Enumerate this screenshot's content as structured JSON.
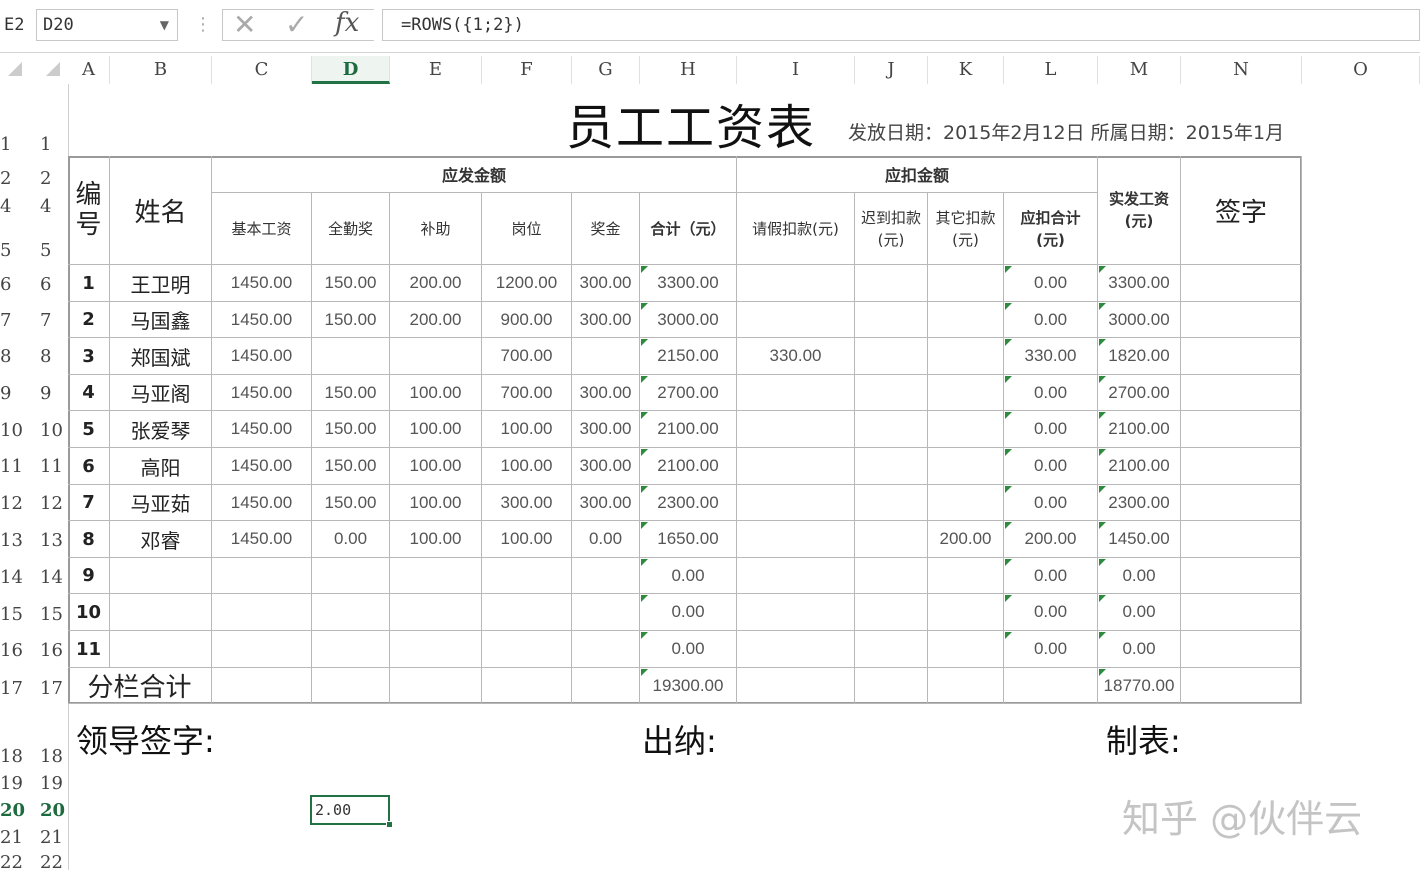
{
  "formula_bar": {
    "cell_hint": "E2",
    "name_box": "D20",
    "formula": "=ROWS({1;2})"
  },
  "columns": [
    "A",
    "B",
    "C",
    "D",
    "E",
    "F",
    "G",
    "H",
    "I",
    "J",
    "K",
    "L",
    "M",
    "N",
    "O"
  ],
  "selected_column": "D",
  "selected_row": "20",
  "rows": [
    {
      "a": "1",
      "b": "1"
    },
    {
      "a": "2",
      "b": "2"
    },
    {
      "a": "4",
      "b": "4"
    },
    {
      "a": "5",
      "b": "5"
    },
    {
      "a": "6",
      "b": "6"
    },
    {
      "a": "7",
      "b": "7"
    },
    {
      "a": "8",
      "b": "8"
    },
    {
      "a": "9",
      "b": "9"
    },
    {
      "a": "10",
      "b": "10"
    },
    {
      "a": "11",
      "b": "11"
    },
    {
      "a": "12",
      "b": "12"
    },
    {
      "a": "13",
      "b": "13"
    },
    {
      "a": "14",
      "b": "14"
    },
    {
      "a": "15",
      "b": "15"
    },
    {
      "a": "16",
      "b": "16"
    },
    {
      "a": "17",
      "b": "17"
    },
    {
      "a": "18",
      "b": "18"
    },
    {
      "a": "19",
      "b": "19"
    },
    {
      "a": "20",
      "b": "20"
    },
    {
      "a": "21",
      "b": "21"
    },
    {
      "a": "22",
      "b": "22"
    }
  ],
  "sheet": {
    "title": "员工工资表",
    "dates": "发放日期：2015年2月12日 所属日期：2015年1月",
    "hdr_id": "编号",
    "hdr_name": "姓名",
    "group_pay": "应发金额",
    "group_deduct": "应扣金额",
    "hdr_net": "实发工资(元)",
    "hdr_sign": "签字",
    "sub_pay": [
      "基本工资",
      "全勤奖",
      "补助",
      "岗位",
      "奖金",
      "合计（元）"
    ],
    "sub_deduct": [
      "请假扣款(元)",
      "迟到扣款(元)",
      "其它扣款(元)",
      "应扣合计(元)"
    ],
    "employees": [
      {
        "id": "1",
        "name": "王卫明",
        "base": "1450.00",
        "attend": "150.00",
        "subsidy": "200.00",
        "post": "1200.00",
        "bonus": "300.00",
        "total": "3300.00",
        "leave": "",
        "late": "",
        "other": "",
        "deduct": "0.00",
        "net": "3300.00"
      },
      {
        "id": "2",
        "name": "马国鑫",
        "base": "1450.00",
        "attend": "150.00",
        "subsidy": "200.00",
        "post": "900.00",
        "bonus": "300.00",
        "total": "3000.00",
        "leave": "",
        "late": "",
        "other": "",
        "deduct": "0.00",
        "net": "3000.00"
      },
      {
        "id": "3",
        "name": "郑国斌",
        "base": "1450.00",
        "attend": "",
        "subsidy": "",
        "post": "700.00",
        "bonus": "",
        "total": "2150.00",
        "leave": "330.00",
        "late": "",
        "other": "",
        "deduct": "330.00",
        "net": "1820.00"
      },
      {
        "id": "4",
        "name": "马亚阁",
        "base": "1450.00",
        "attend": "150.00",
        "subsidy": "100.00",
        "post": "700.00",
        "bonus": "300.00",
        "total": "2700.00",
        "leave": "",
        "late": "",
        "other": "",
        "deduct": "0.00",
        "net": "2700.00"
      },
      {
        "id": "5",
        "name": "张爱琴",
        "base": "1450.00",
        "attend": "150.00",
        "subsidy": "100.00",
        "post": "100.00",
        "bonus": "300.00",
        "total": "2100.00",
        "leave": "",
        "late": "",
        "other": "",
        "deduct": "0.00",
        "net": "2100.00"
      },
      {
        "id": "6",
        "name": "高阳",
        "base": "1450.00",
        "attend": "150.00",
        "subsidy": "100.00",
        "post": "100.00",
        "bonus": "300.00",
        "total": "2100.00",
        "leave": "",
        "late": "",
        "other": "",
        "deduct": "0.00",
        "net": "2100.00"
      },
      {
        "id": "7",
        "name": "马亚茹",
        "base": "1450.00",
        "attend": "150.00",
        "subsidy": "100.00",
        "post": "300.00",
        "bonus": "300.00",
        "total": "2300.00",
        "leave": "",
        "late": "",
        "other": "",
        "deduct": "0.00",
        "net": "2300.00"
      },
      {
        "id": "8",
        "name": "邓睿",
        "base": "1450.00",
        "attend": "0.00",
        "subsidy": "100.00",
        "post": "100.00",
        "bonus": "0.00",
        "total": "1650.00",
        "leave": "",
        "late": "",
        "other": "200.00",
        "deduct": "200.00",
        "net": "1450.00"
      },
      {
        "id": "9",
        "name": "",
        "base": "",
        "attend": "",
        "subsidy": "",
        "post": "",
        "bonus": "",
        "total": "0.00",
        "leave": "",
        "late": "",
        "other": "",
        "deduct": "0.00",
        "net": "0.00"
      },
      {
        "id": "10",
        "name": "",
        "base": "",
        "attend": "",
        "subsidy": "",
        "post": "",
        "bonus": "",
        "total": "0.00",
        "leave": "",
        "late": "",
        "other": "",
        "deduct": "0.00",
        "net": "0.00"
      },
      {
        "id": "11",
        "name": "",
        "base": "",
        "attend": "",
        "subsidy": "",
        "post": "",
        "bonus": "",
        "total": "0.00",
        "leave": "",
        "late": "",
        "other": "",
        "deduct": "0.00",
        "net": "0.00"
      }
    ],
    "subtotal_label": "分栏合计",
    "subtotal_total": "19300.00",
    "subtotal_net": "18770.00",
    "sign_leader": "领导签字:",
    "sign_cashier": "出纳:",
    "sign_maker": "制表:",
    "active_cell_value": "2.00"
  },
  "watermark": "知乎 @伙伴云",
  "colors": {
    "accent": "#217346",
    "grid": "#b8b8b8",
    "marker": "#2e8b3e"
  }
}
